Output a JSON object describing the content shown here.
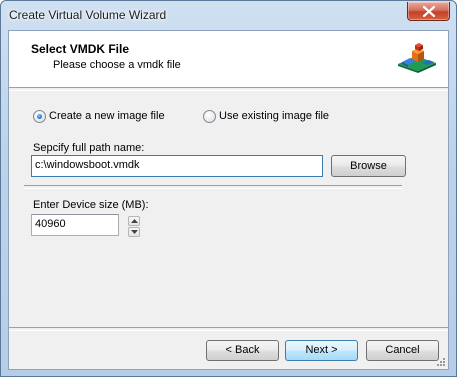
{
  "window": {
    "title": "Create Virtual Volume Wizard"
  },
  "header": {
    "title": "Select VMDK File",
    "subtitle": "Please choose a vmdk file",
    "icon": "cubes-icon"
  },
  "options": {
    "create_new": {
      "label": "Create a new image file",
      "checked": true
    },
    "use_existing": {
      "label": "Use existing image file",
      "checked": false
    }
  },
  "path": {
    "label": "Sepcify full path name:",
    "value": "c:\\windowsboot.vmdk",
    "browse_label": "Browse"
  },
  "size": {
    "label": "Enter Device size (MB):",
    "value": "40960"
  },
  "footer": {
    "back_label": "< Back",
    "next_label": "Next >",
    "cancel_label": "Cancel"
  },
  "colors": {
    "accent": "#3c7fb1",
    "close_button": "#c2412a"
  }
}
